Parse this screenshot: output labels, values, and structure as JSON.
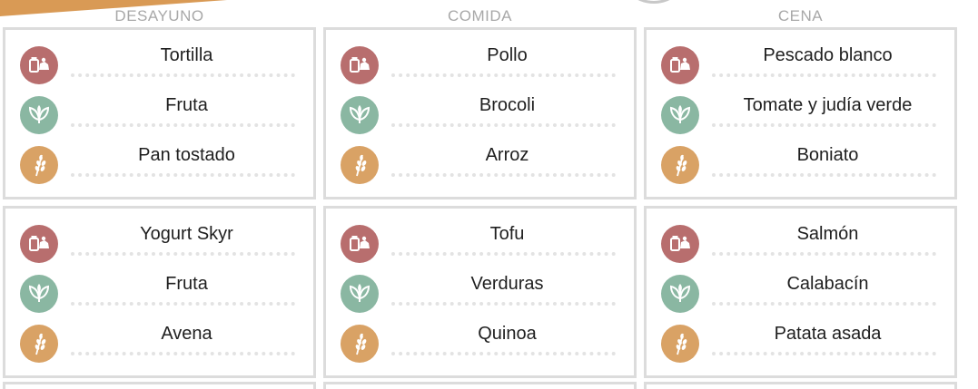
{
  "columns": [
    {
      "header": "DESAYUNO"
    },
    {
      "header": "COMIDA"
    },
    {
      "header": "CENA"
    }
  ],
  "days": [
    {
      "meals": [
        {
          "items": [
            {
              "category": "protein",
              "icon": "protein-icon",
              "name": "Tortilla"
            },
            {
              "category": "veg",
              "icon": "leaf-icon",
              "name": "Fruta"
            },
            {
              "category": "carb",
              "icon": "wheat-icon",
              "name": "Pan tostado"
            }
          ]
        },
        {
          "items": [
            {
              "category": "protein",
              "icon": "protein-icon",
              "name": "Pollo"
            },
            {
              "category": "veg",
              "icon": "leaf-icon",
              "name": "Brocoli"
            },
            {
              "category": "carb",
              "icon": "wheat-icon",
              "name": "Arroz"
            }
          ]
        },
        {
          "items": [
            {
              "category": "protein",
              "icon": "protein-icon",
              "name": "Pescado blanco"
            },
            {
              "category": "veg",
              "icon": "leaf-icon",
              "name": "Tomate y judía verde"
            },
            {
              "category": "carb",
              "icon": "wheat-icon",
              "name": "Boniato"
            }
          ]
        }
      ]
    },
    {
      "meals": [
        {
          "items": [
            {
              "category": "protein",
              "icon": "protein-icon",
              "name": "Yogurt Skyr"
            },
            {
              "category": "veg",
              "icon": "leaf-icon",
              "name": "Fruta"
            },
            {
              "category": "carb",
              "icon": "wheat-icon",
              "name": "Avena"
            }
          ]
        },
        {
          "items": [
            {
              "category": "protein",
              "icon": "protein-icon",
              "name": "Tofu"
            },
            {
              "category": "veg",
              "icon": "leaf-icon",
              "name": "Verduras"
            },
            {
              "category": "carb",
              "icon": "wheat-icon",
              "name": "Quinoa"
            }
          ]
        },
        {
          "items": [
            {
              "category": "protein",
              "icon": "protein-icon",
              "name": "Salmón"
            },
            {
              "category": "veg",
              "icon": "leaf-icon",
              "name": "Calabacín"
            },
            {
              "category": "carb",
              "icon": "wheat-icon",
              "name": "Patata asada"
            }
          ]
        }
      ]
    }
  ],
  "colors": {
    "protein": "#b86e6e",
    "veg": "#8ab7a2",
    "carb": "#d9a265",
    "border": "#dcdcdc",
    "header_text": "#a8a8a8"
  }
}
